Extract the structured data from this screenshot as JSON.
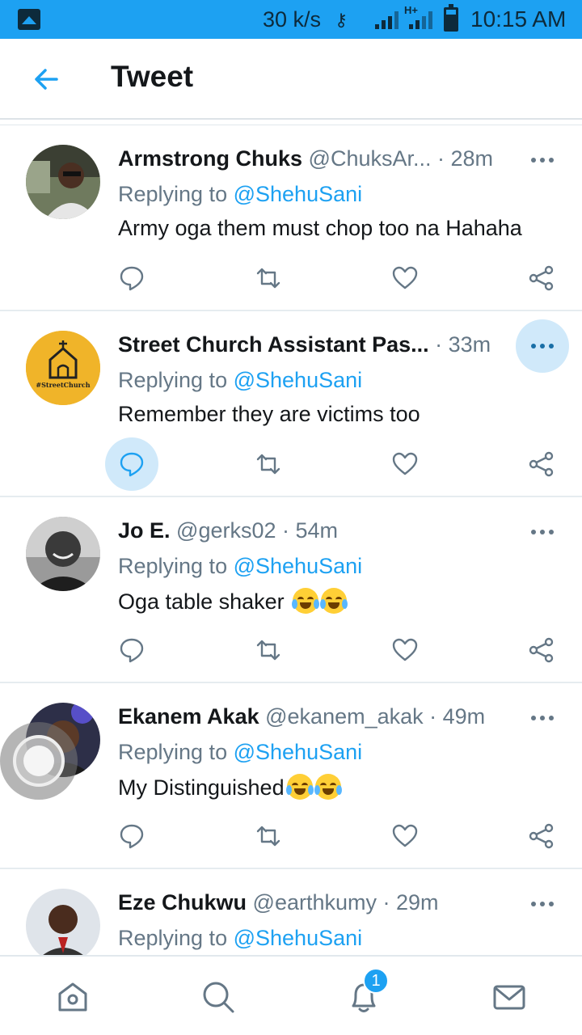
{
  "status_bar": {
    "speed": "30 k/s",
    "network": "H+",
    "time": "10:15 AM"
  },
  "header": {
    "title": "Tweet"
  },
  "tweets": [
    {
      "name": "Armstrong Chuks",
      "handle": "@ChuksAr...",
      "time": "· 28m",
      "replying_prefix": "Replying to",
      "replying_to": "@ShehuSani",
      "text": "Army oga them must chop too na Hahaha"
    },
    {
      "name": "Street Church Assistant Pas...",
      "handle": "",
      "time": "· 33m",
      "replying_prefix": "Replying to",
      "replying_to": "@ShehuSani",
      "text": "Remember they are victims too",
      "avatar_text": "#StreetChurch"
    },
    {
      "name": "Jo E.",
      "handle": "@gerks02",
      "time": "· 54m",
      "replying_prefix": "Replying to",
      "replying_to": "@ShehuSani",
      "text": "Oga table shaker"
    },
    {
      "name": "Ekanem Akak",
      "handle": "@ekanem_akak",
      "time": "· 49m",
      "replying_prefix": "Replying to",
      "replying_to": "@ShehuSani",
      "text": "My Distinguished"
    },
    {
      "name": "Eze Chukwu",
      "handle": "@earthkumy",
      "time": "· 29m",
      "replying_prefix": "Replying to",
      "replying_to": "@ShehuSani",
      "text": ""
    }
  ],
  "bottom_nav": {
    "notification_count": "1"
  },
  "colors": {
    "accent": "#1da1f2",
    "text_primary": "#14171a",
    "text_secondary": "#657786",
    "highlight": "#d0e9fa"
  }
}
